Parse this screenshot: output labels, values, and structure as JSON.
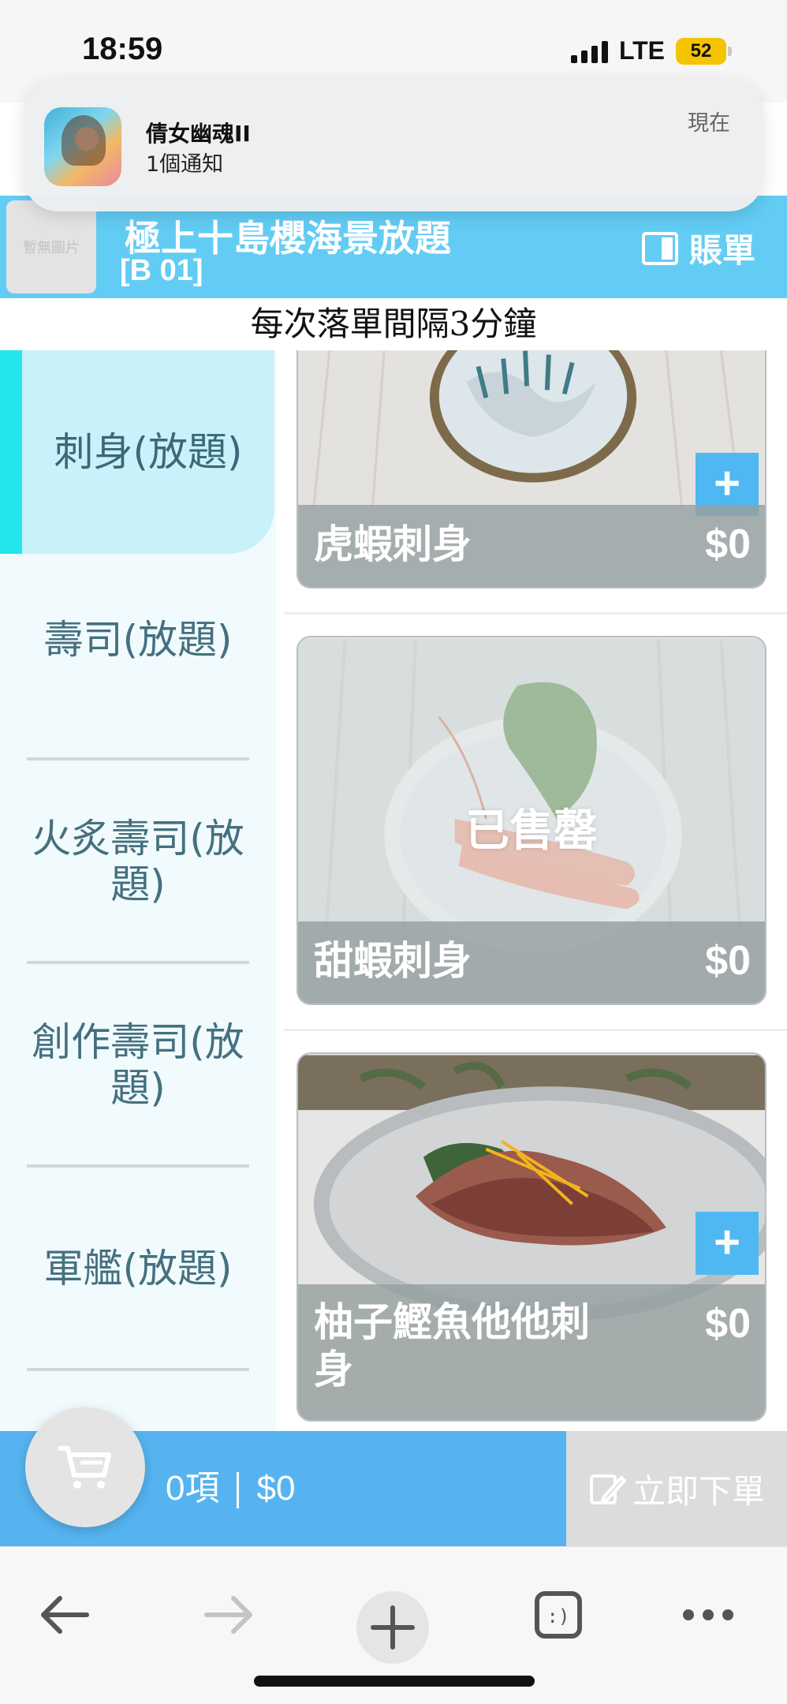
{
  "status_bar": {
    "time": "18:59",
    "network": "LTE",
    "battery": "52",
    "signal_bars": 4,
    "icons": [
      "signal-icon",
      "battery-icon"
    ]
  },
  "notification": {
    "app_name": "倩女幽魂II",
    "message": "1個通知",
    "time": "現在",
    "icon": "game-app-icon"
  },
  "header": {
    "no_image_text": "暫無圖片",
    "title": "極上十島櫻海景放題",
    "table": "[B 01]",
    "bill_label": "賬單",
    "bill_icon": "bill-icon",
    "background_color": "#62ccf4"
  },
  "notice": "每次落單間隔3分鐘",
  "categories": [
    {
      "label": "刺身(放題)",
      "active": true
    },
    {
      "label": "壽司(放題)",
      "active": false
    },
    {
      "label": "火炙壽司(放題)",
      "active": false
    },
    {
      "label": "創作壽司(放題)",
      "active": false
    },
    {
      "label": "軍艦(放題)",
      "active": false
    }
  ],
  "products": [
    {
      "name": "虎蝦刺身",
      "price": "$0",
      "sold_out": false,
      "add_label": "+",
      "image": "tiger-prawn-sashimi-photo"
    },
    {
      "name": "甜蝦刺身",
      "price": "$0",
      "sold_out": true,
      "sold_out_label": "已售罄",
      "image": "sweet-shrimp-sashimi-photo"
    },
    {
      "name": "柚子鰹魚他他刺身",
      "price": "$0",
      "sold_out": false,
      "add_label": "+",
      "image": "yuzu-bonito-tataki-photo"
    }
  ],
  "order_bar": {
    "items": "0項",
    "total": "$0",
    "order_now": "立即下單",
    "cart_icon": "cart-icon",
    "order_icon": "edit-order-icon",
    "accent_color": "#55b4f0"
  },
  "browser": {
    "icons": [
      "back-arrow-icon",
      "forward-arrow-icon",
      "new-tab-plus-icon",
      "tabs-icon",
      "more-icon"
    ]
  },
  "colors": {
    "active_category_bg": "#c8f1fa",
    "active_indicator": "#22e6ec",
    "add_button": "#4fb8f2"
  }
}
